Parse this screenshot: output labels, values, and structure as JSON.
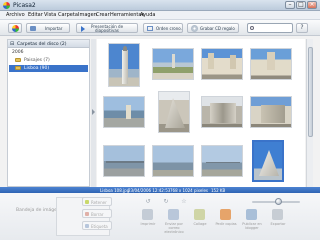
{
  "window": {
    "title": "Picasa2"
  },
  "menu": [
    "Archivo",
    "Editar",
    "Vista",
    "Carpeta",
    "Imagen",
    "Crear",
    "Herramientas",
    "Ayuda"
  ],
  "toolbar": {
    "import_label": "Importar",
    "presentation_label_1": "Presentación de",
    "presentation_label_2": "diapositivas",
    "timeline_label": "Orden crono.",
    "burn_cd_label": "Grabar CD regalo",
    "search_value": "",
    "help_label": "?"
  },
  "sidebar": {
    "header": "Carpetas del disco (2)",
    "year": "2006",
    "folders": [
      {
        "label": "Paisajes (7)"
      },
      {
        "label": "Lisboa (90)",
        "selected": true
      }
    ]
  },
  "thumbnails": [
    {
      "name": "monument-column"
    },
    {
      "name": "square-fountain"
    },
    {
      "name": "monastery-facade"
    },
    {
      "name": "monastery-towers"
    },
    {
      "name": "tower-river"
    },
    {
      "name": "discoveries-monument"
    },
    {
      "name": "monument-sculpture"
    },
    {
      "name": "monument-side"
    },
    {
      "name": "bridge-river"
    },
    {
      "name": "river-bank"
    },
    {
      "name": "bridge-distance"
    },
    {
      "name": "monument-blue-sky",
      "selected": true
    }
  ],
  "status": {
    "filename": "Lisboa 108.jpg",
    "datetime": "23/04/2006 12:42:53",
    "dimensions": "768 x 1024 pixeles",
    "size": "152 KB"
  },
  "bottom": {
    "tray_label": "Bandeja de imágenes",
    "tray_buttons": [
      "Retener",
      "Borrar",
      "Etiqueta"
    ],
    "actions": [
      "Imprimir",
      "Enviar por correo electrónico",
      "Collage",
      "Pedir copias",
      "Publicar en blogger",
      "Exportar"
    ]
  },
  "colors": {
    "accent": "#3a73c9",
    "status_bar": "#3d72c2",
    "folder": "#e5c25a"
  }
}
